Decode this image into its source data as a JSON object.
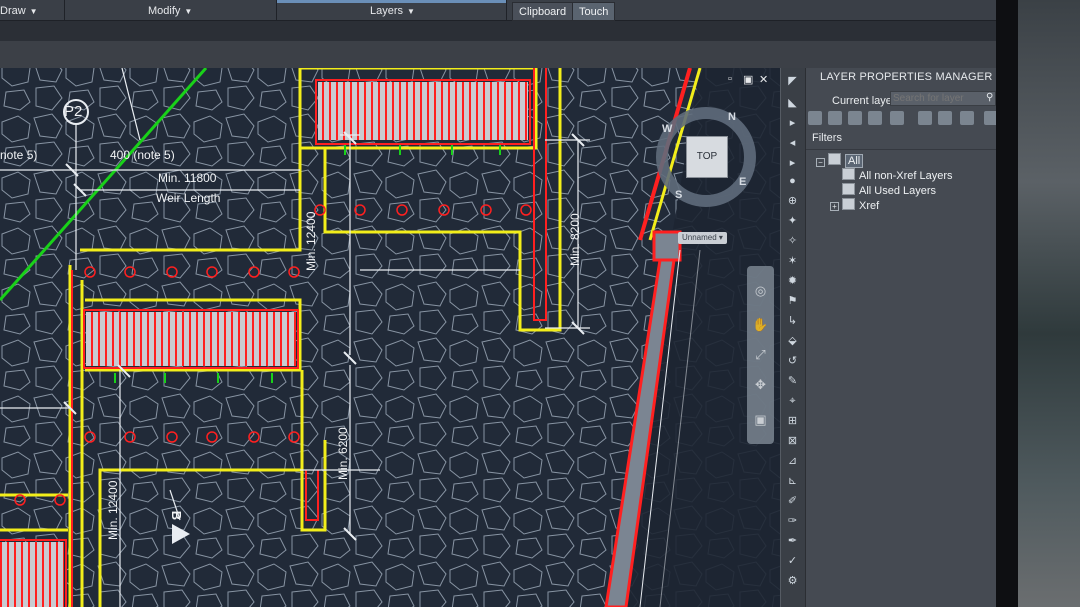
{
  "ribbon": {
    "panels": [
      {
        "label": "Draw",
        "has_caret": true
      },
      {
        "label": "Modify",
        "has_caret": true
      },
      {
        "label": "Layers",
        "has_caret": true
      }
    ],
    "tabs": [
      {
        "label": "Clipboard",
        "active": false
      },
      {
        "label": "Touch",
        "active": true
      }
    ]
  },
  "viewport": {
    "restore_glyph": "▫",
    "maximize_glyph": "▣",
    "close_glyph": "✕"
  },
  "viewcube": {
    "face_label": "TOP",
    "compass": {
      "n": "N",
      "e": "E",
      "s": "S",
      "w": "W"
    },
    "ucs_menu": "Unnamed"
  },
  "drawing": {
    "labels": {
      "p2": "P2",
      "note5_left": "note 5)",
      "note5_dim": "400 (note 5)",
      "min_11800": "Min. 11800",
      "weir_length": "Weir Length",
      "min_12400_v": "Min. 12400",
      "min_8200_v": "Min. 8200",
      "min_6200_v": "Min. 6200",
      "min_12400_v2": "Min. 12400",
      "section_b": "B"
    },
    "colors": {
      "background": "#212a38",
      "rock": "#a9b4c2",
      "yellow": "#f2ee1a",
      "red": "#ff1f1f",
      "green": "#19d119",
      "white": "#e9edf2"
    }
  },
  "layer_manager": {
    "title": "LAYER PROPERTIES MANAGER",
    "current_layer_label": "Current layer",
    "search_placeholder": "Search for layer",
    "filters_label": "Filters",
    "tree": [
      {
        "label": "All",
        "selected": true
      },
      {
        "label": "All non-Xref Layers",
        "selected": false
      },
      {
        "label": "All Used Layers",
        "selected": false
      },
      {
        "label": "Xref",
        "selected": false
      }
    ]
  },
  "icons": {
    "search": "search-icon",
    "pan": "pan-hand-icon",
    "zoom": "zoom-icon",
    "orbit": "orbit-icon",
    "steering_wheel": "steering-wheel-icon",
    "showmotion": "showmotion-icon"
  }
}
